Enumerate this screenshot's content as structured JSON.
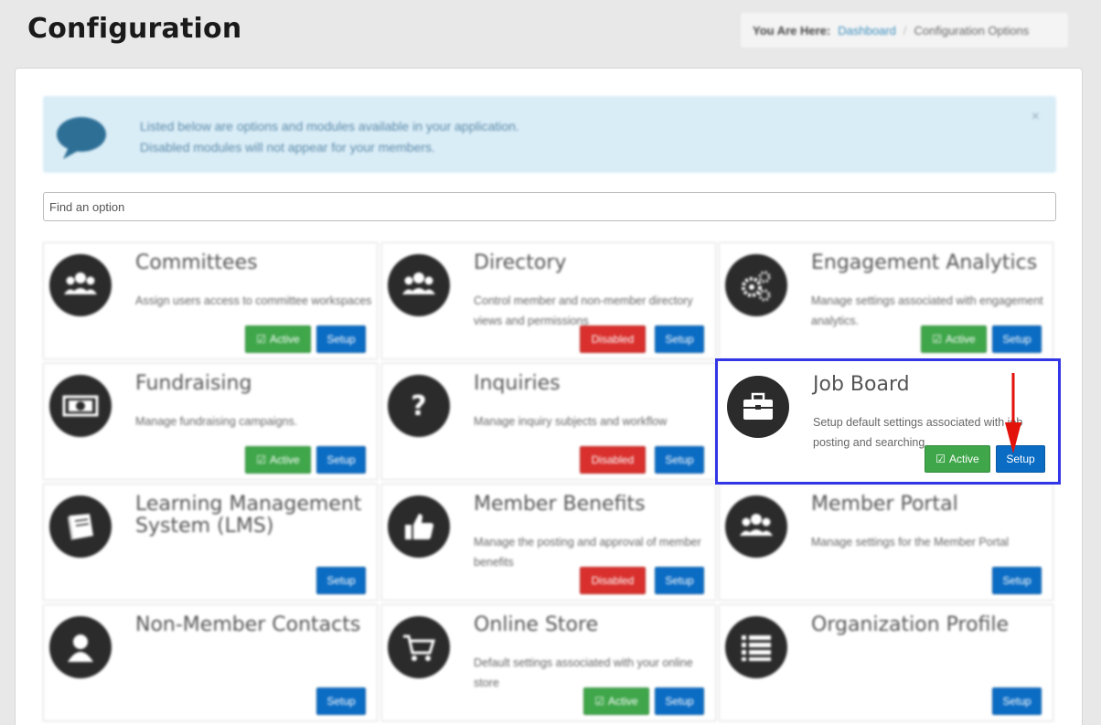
{
  "page": {
    "title": "Configuration"
  },
  "breadcrumb": {
    "label": "You Are Here:",
    "home": "Dashboard",
    "separator": "/",
    "current": "Configuration Options"
  },
  "alert": {
    "line1": "Listed below are options and modules available in your application.",
    "line2": "Disabled modules will not appear for your members.",
    "close": "×"
  },
  "search": {
    "placeholder": "Find an option",
    "value": ""
  },
  "buttons": {
    "setup": "Setup",
    "active": "Active",
    "disabled": "Disabled"
  },
  "modules": [
    {
      "title": "Committees",
      "desc": "Assign users access to committee workspaces",
      "status": "active",
      "icon": "users-icon"
    },
    {
      "title": "Directory",
      "desc": "Control member and non-member directory views and permissions",
      "status": "disabled",
      "icon": "users-icon"
    },
    {
      "title": "Engagement Analytics",
      "desc": "Manage settings associated with engagement analytics.",
      "status": "active",
      "icon": "gears-icon"
    },
    {
      "title": "Fundraising",
      "desc": "Manage fundraising campaigns.",
      "status": "active",
      "icon": "money-icon"
    },
    {
      "title": "Inquiries",
      "desc": "Manage inquiry subjects and workflow",
      "status": "disabled",
      "icon": "question-icon"
    },
    {
      "title": "Job Board",
      "desc": "Setup default settings associated with job posting and searching",
      "status": "active",
      "icon": "briefcase-icon"
    },
    {
      "title": "Learning Management System (LMS)",
      "desc": "",
      "status": "none",
      "icon": "book-icon"
    },
    {
      "title": "Member Benefits",
      "desc": "Manage the posting and approval of member benefits",
      "status": "disabled",
      "icon": "thumbs-up-icon"
    },
    {
      "title": "Member Portal",
      "desc": "Manage settings for the Member Portal",
      "status": "none",
      "icon": "users-icon"
    },
    {
      "title": "Non-Member Contacts",
      "desc": "",
      "status": "none",
      "icon": "user-icon"
    },
    {
      "title": "Online Store",
      "desc": "Default settings associated with your online store",
      "status": "active",
      "icon": "cart-icon"
    },
    {
      "title": "Organization Profile",
      "desc": "",
      "status": "none",
      "icon": "list-icon"
    }
  ],
  "colors": {
    "setup": "#0b6cc4",
    "active": "#3fa64a",
    "disabled": "#d9302d",
    "highlight": "#3336e6",
    "arrow": "#e3120b"
  }
}
